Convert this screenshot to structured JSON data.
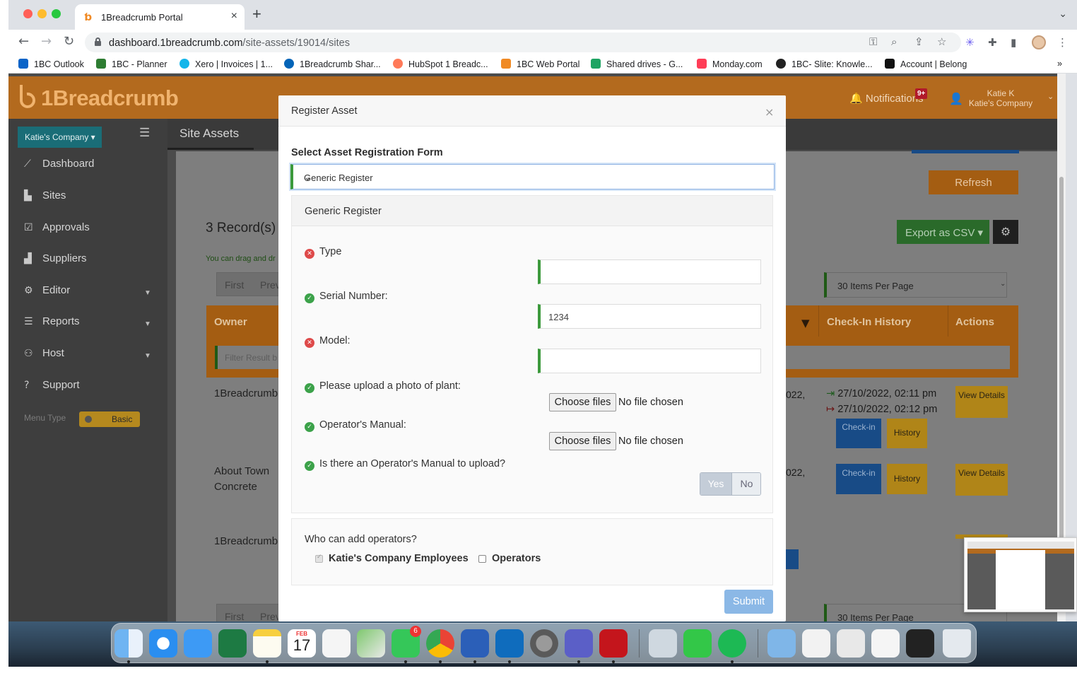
{
  "browser": {
    "tab_title": "1Breadcrumb Portal",
    "tab_favicon": "1breadcrumb-favicon",
    "close_tab": "×",
    "new_tab": "+",
    "url_host": "dashboard.1breadcrumb.com",
    "url_path": "/site-assets/19014/sites",
    "bookmarks": [
      {
        "label": "1BC Outlook",
        "color": "#0a64c8"
      },
      {
        "label": "1BC - Planner",
        "color": "#2e7d32"
      },
      {
        "label": "Xero | Invoices | 1...",
        "color": "#13b5ea"
      },
      {
        "label": "1Breadcrumb Shar...",
        "color": "#0364b8"
      },
      {
        "label": "HubSpot 1 Breadc...",
        "color": "#ff7a59"
      },
      {
        "label": "1BC Web Portal",
        "color": "#f08a24"
      },
      {
        "label": "Shared drives - G...",
        "color": "#1fa463"
      },
      {
        "label": "Monday.com",
        "color": "#ff3d57"
      },
      {
        "label": "1BC- Slite: Knowle...",
        "color": "#222222"
      },
      {
        "label": "Account | Belong",
        "color": "#111111"
      }
    ],
    "bookmarks_more": "»"
  },
  "app": {
    "logo_text": "1Breadcrumb",
    "notifications_label": "Notifications",
    "notifications_badge": "9+",
    "user_name": "Katie K",
    "user_company": "Katie's Company",
    "company_button": "Katie's Company ▾",
    "page_title": "Site Assets",
    "sidebar": [
      {
        "label": "Dashboard",
        "icon": "📈"
      },
      {
        "label": "Sites",
        "icon": "▙"
      },
      {
        "label": "Approvals",
        "icon": "☑"
      },
      {
        "label": "Suppliers",
        "icon": "▟"
      },
      {
        "label": "Editor",
        "icon": "⚙"
      },
      {
        "label": "Reports",
        "icon": "☰"
      },
      {
        "label": "Host",
        "icon": "👥"
      },
      {
        "label": "Support",
        "icon": "?"
      }
    ],
    "menu_type_label": "Menu Type",
    "menu_type_value": "Basic",
    "refresh_button": "Refresh",
    "records_count": "3 Record(s)",
    "drag_note": "You can drag and dr",
    "export_button": "Export as CSV ▾",
    "pager_first": "First",
    "pager_prev": "Prev",
    "per_page": "30 Items Per Page",
    "columns": [
      "Owner",
      "Check-In History",
      "Actions"
    ],
    "filter_placeholder": "Filter Result b",
    "rows": [
      {
        "owner": "1Breadcrumb",
        "date_fragment": "022,",
        "checkin_in": "27/10/2022, 02:11 pm",
        "checkin_out": "27/10/2022, 02:12 pm",
        "checkin_btn": "Check-in",
        "history_btn": "History",
        "view_btn": "View Details"
      },
      {
        "owner": "About Town Concrete",
        "date_fragment": "022,",
        "checkin_btn": "Check-in",
        "history_btn": "History",
        "view_btn": "View Details"
      },
      {
        "owner": "1Breadcrumb"
      }
    ]
  },
  "modal": {
    "title": "Register Asset",
    "close": "×",
    "select_label": "Select Asset Registration Form",
    "select_value": "Generic Register",
    "form_title": "Generic Register",
    "fields": [
      {
        "label": "Type",
        "status": "invalid",
        "value": ""
      },
      {
        "label": "Serial Number:",
        "status": "valid",
        "value": "1234"
      },
      {
        "label": "Model:",
        "status": "invalid",
        "value": ""
      },
      {
        "label": "Please upload a photo of plant:",
        "status": "valid",
        "button": "Choose files",
        "file_status": "No file chosen"
      },
      {
        "label": "Operator's Manual:",
        "status": "valid",
        "button": "Choose files",
        "file_status": "No file chosen"
      },
      {
        "label": "Is there an Operator's Manual to upload?",
        "status": "valid",
        "yes": "Yes",
        "no": "No"
      }
    ],
    "operators_title": "Who can add operators?",
    "operators_options": [
      {
        "label": "Katie's Company Employees",
        "checked": true
      },
      {
        "label": "Operators",
        "checked": false
      }
    ],
    "submit": "Submit"
  },
  "dock": {
    "calendar_month": "FEB",
    "calendar_day": "17",
    "messages_badge": "6"
  }
}
